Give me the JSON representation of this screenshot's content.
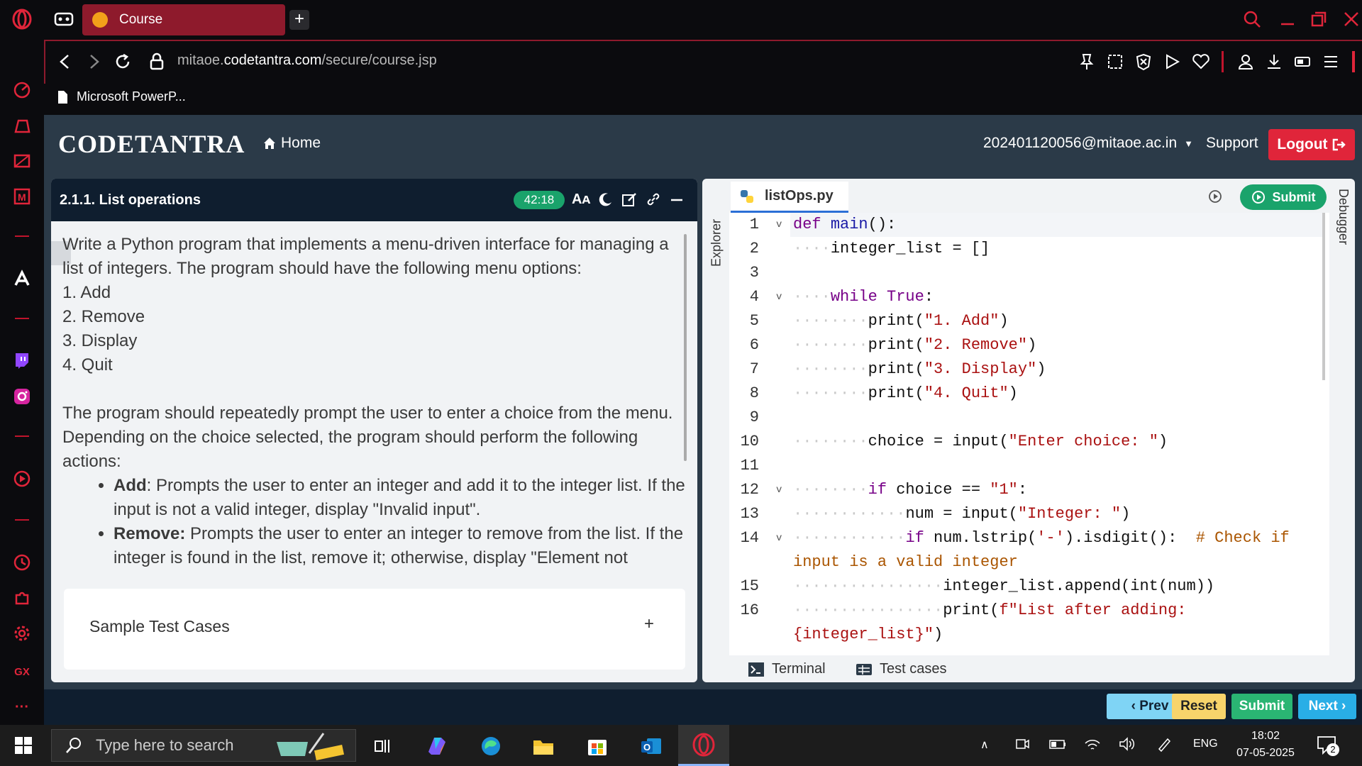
{
  "browser": {
    "tab_title": "Course",
    "url_domain_prefix": "mitaoe.",
    "url_domain": "codetantra.com",
    "url_path": "/secure/course.jsp",
    "bookmark_label": "Microsoft PowerP..."
  },
  "site": {
    "logo_text": "CODETANTRA",
    "home_label": "Home",
    "user_email": "202401120056@mitaoe.ac.in",
    "support_label": "Support",
    "logout_label": "Logout"
  },
  "problem": {
    "title": "2.1.1. List operations",
    "timer": "42:18",
    "desc_p1": "Write a Python program that implements a menu-driven interface for managing a list of integers. The program should have the following menu options:",
    "menu_items": [
      "1. Add",
      "2. Remove",
      "3. Display",
      "4. Quit"
    ],
    "desc_p2": "The program should repeatedly prompt the user to enter a choice from the menu. Depending on the choice selected, the program should perform the following actions:",
    "bullet1_bold": "Add",
    "bullet1_text": ": Prompts the user to enter an integer and add it to the integer list. If the input is not a valid integer, display \"Invalid input\".",
    "bullet2_bold": "Remove:",
    "bullet2_text": " Prompts the user to enter an integer to remove from the list. If the integer is found in the list, remove it; otherwise, display \"Element not",
    "sample_tests_label": "Sample Test Cases",
    "sample_tests_toggle": "+"
  },
  "editor": {
    "explorer_label": "Explorer",
    "debugger_label": "Debugger",
    "file_tab": "listOps.py",
    "submit_label": "Submit",
    "terminal_label": "Terminal",
    "testcases_label": "Test cases",
    "line_numbers": [
      "1",
      "2",
      "3",
      "4",
      "5",
      "6",
      "7",
      "8",
      "9",
      "10",
      "11",
      "12",
      "13",
      "14",
      "15",
      "16"
    ]
  },
  "footer_buttons": {
    "prev": "‹ Prev",
    "reset": "Reset",
    "submit": "Submit",
    "next": "Next ›"
  },
  "taskbar": {
    "search_placeholder": "Type here to search",
    "language": "ENG",
    "time": "18:02",
    "date": "07-05-2025",
    "notification_count": "2"
  },
  "colors": {
    "opera_red": "#c0142c",
    "tab_active": "#8e1a2c",
    "site_bg": "#2b3a48",
    "logout_red": "#e0253a",
    "timer_green": "#1aa36b",
    "prev_btn": "#7fd4f5",
    "reset_btn": "#f7d46b",
    "submit_btn": "#2ab573",
    "next_btn": "#29aee6"
  }
}
